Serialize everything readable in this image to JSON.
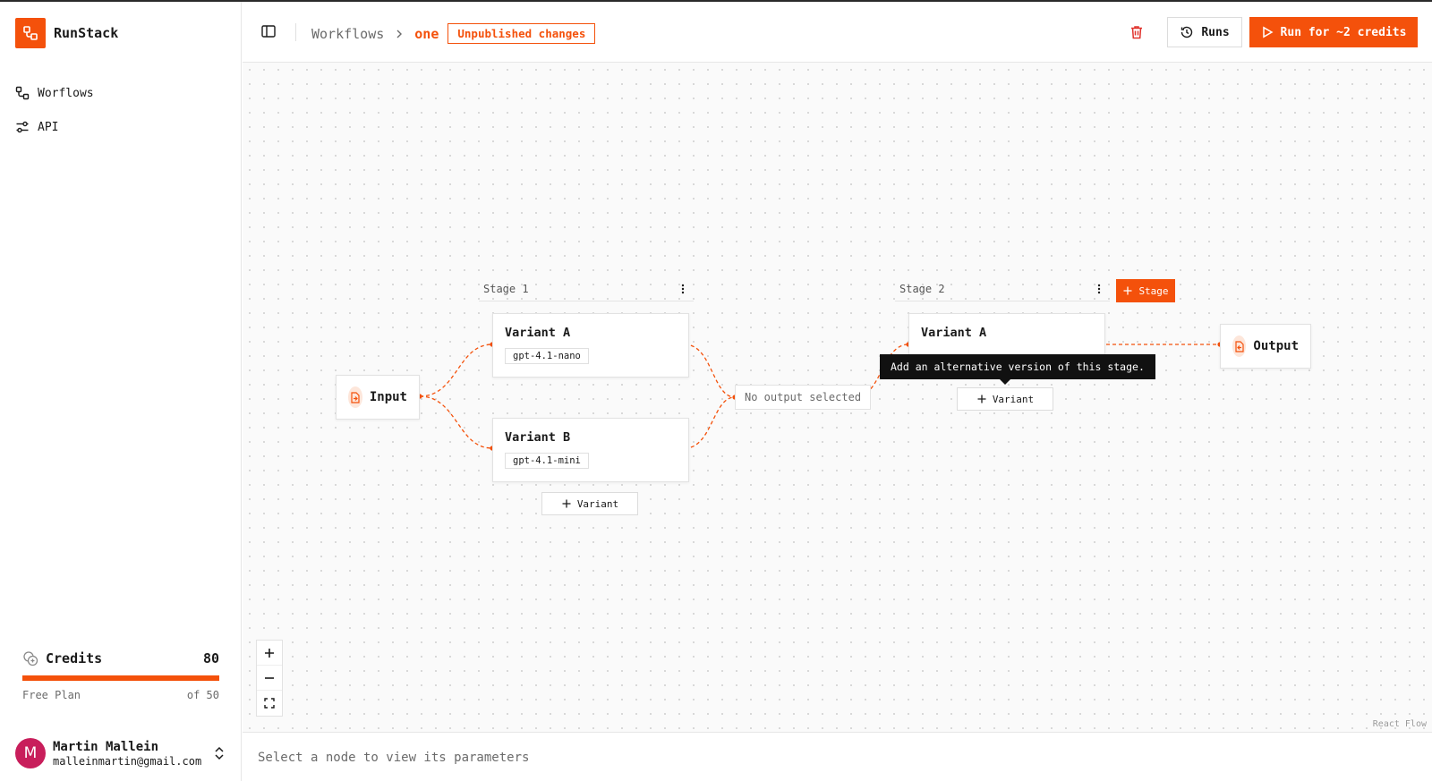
{
  "app": {
    "name": "RunStack",
    "accent": "#f4510b"
  },
  "sidebar": {
    "items": [
      {
        "label": "Worflows",
        "icon": "workflow-icon"
      },
      {
        "label": "API",
        "icon": "settings-sliders-icon"
      }
    ],
    "credits": {
      "label": "Credits",
      "count": "80",
      "plan": "Free Plan",
      "limit_text": "of 50",
      "fill_fraction": 1.0
    },
    "user": {
      "initial": "M",
      "name": "Martin Mallein",
      "email": "malleinmartin@gmail.com",
      "avatar_color": "#c81e5b"
    }
  },
  "header": {
    "breadcrumb_root": "Workflows",
    "breadcrumb_current": "one",
    "status_badge": "Unpublished changes",
    "runs_label": "Runs",
    "run_label": "Run for ~2 credits"
  },
  "canvas": {
    "input_label": "Input",
    "output_label": "Output",
    "stages": [
      {
        "label": "Stage 1",
        "variants": [
          {
            "title": "Variant A",
            "model": "gpt-4.1-nano"
          },
          {
            "title": "Variant B",
            "model": "gpt-4.1-mini"
          }
        ],
        "add_variant_label": "Variant"
      },
      {
        "label": "Stage 2",
        "variants": [
          {
            "title": "Variant A",
            "model": ""
          }
        ],
        "add_variant_label": "Variant"
      }
    ],
    "merge_label": "No output selected",
    "add_stage_label": "Stage",
    "tooltip": "Add an alternative version of this stage.",
    "attribution": "React Flow",
    "edge_color": "#f4510b"
  },
  "panel": {
    "placeholder": "Select a node to view its parameters"
  }
}
